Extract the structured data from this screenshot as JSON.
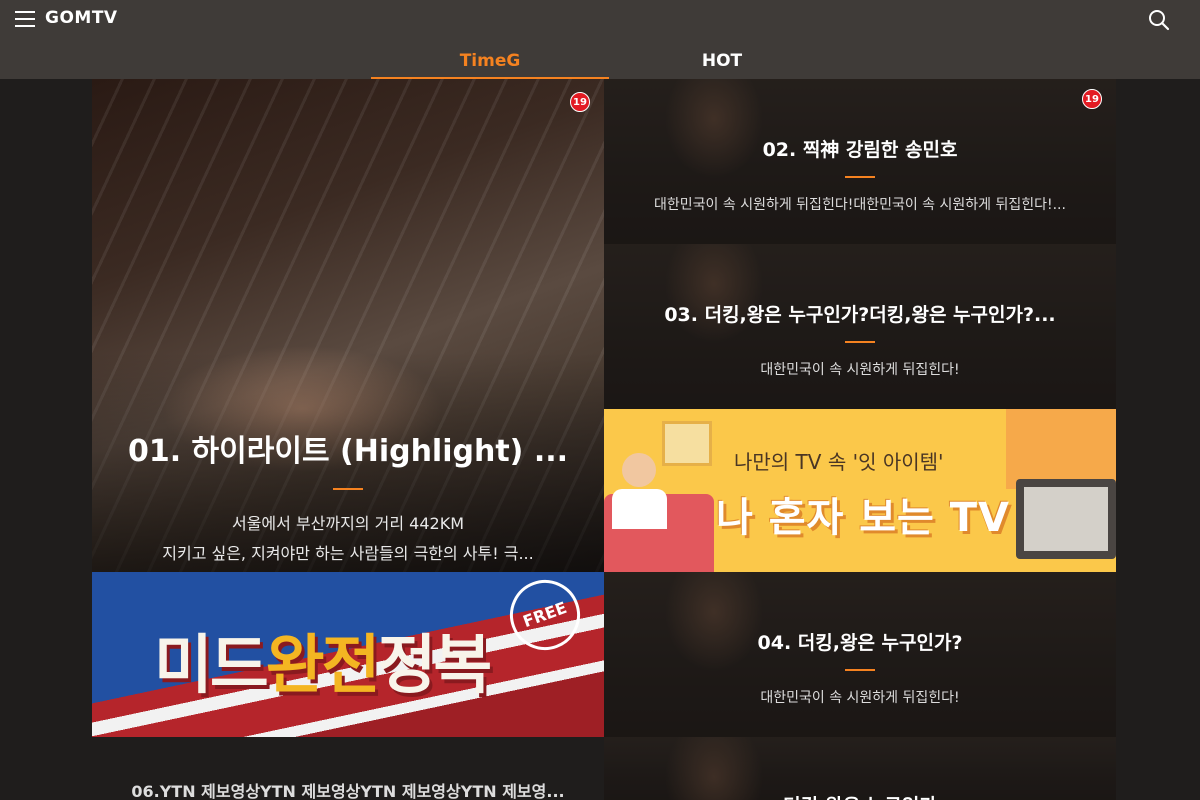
{
  "header": {
    "logo": "GOMTV",
    "menu_icon": "hamburger-menu-icon",
    "search_icon": "search-icon"
  },
  "tabs": [
    {
      "label": "TimeG",
      "active": true
    },
    {
      "label": "HOT",
      "active": false
    }
  ],
  "accent_color": "#f58220",
  "tiles": {
    "main": {
      "age": "19",
      "title": "01. 하이라이트 (Highlight) ...",
      "desc_line1": "서울에서 부산까지의 거리 442KM",
      "desc_line2": "지키고 싶은, 지켜야만 하는 사람들의 극한의 사투! 극..."
    },
    "t02": {
      "age": "19",
      "title": "02. 찍神 강림한 송민호",
      "desc": "대한민국이 속 시원하게 뒤집힌다!대한민국이 속 시원하게 뒤집힌다!..."
    },
    "t03": {
      "title": "03. 더킹,왕은 누구인가?더킹,왕은 누구인가?...",
      "desc": "대한민국이 속 시원하게 뒤집힌다!"
    },
    "t04": {
      "title": "04. 더킹,왕은 누구인가?",
      "desc": "대한민국이 속 시원하게 뒤집힌다!"
    },
    "t06": {
      "title": "06.YTN 제보영상YTN 제보영상YTN 제보영상YTN 제보영..."
    },
    "t07": {
      "title": "더킹,왕은 누구인가"
    }
  },
  "ad_banner": {
    "subtitle": "나만의 TV 속 '잇 아이템'",
    "title": "나 혼자 보는 TV"
  },
  "drama_banner": {
    "title_part1": "미드",
    "title_part2": "완전",
    "title_part3": "정복",
    "badge": "FREE"
  }
}
